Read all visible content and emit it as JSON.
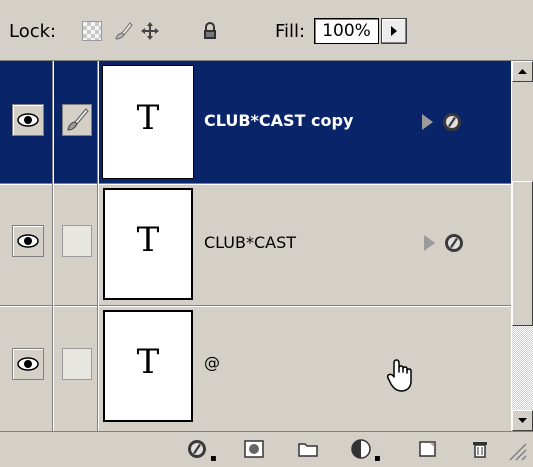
{
  "lock_bar": {
    "lock_label": "Lock:",
    "fill_label": "Fill:",
    "fill_value": "100%",
    "icons": [
      "lock-transparent-icon",
      "lock-image-brush-icon",
      "lock-position-move-icon",
      "lock-all-padlock-icon"
    ]
  },
  "layers": [
    {
      "name": "CLUB*CAST copy",
      "thumb": "T",
      "selected": true,
      "visible": true,
      "has_effects": true
    },
    {
      "name": "CLUB*CAST",
      "thumb": "T",
      "selected": false,
      "visible": true,
      "has_effects": true
    },
    {
      "name": "@",
      "thumb": "T",
      "selected": false,
      "visible": true,
      "has_effects": false
    }
  ],
  "bottom_bar": {
    "icons": [
      "add-layer-style-icon",
      "add-layer-mask-icon",
      "new-group-folder-icon",
      "new-adjustment-layer-icon",
      "new-layer-icon",
      "delete-layer-trash-icon"
    ]
  },
  "colors": {
    "panel_bg": "#d4d0c8",
    "selection": "#0a246a"
  }
}
